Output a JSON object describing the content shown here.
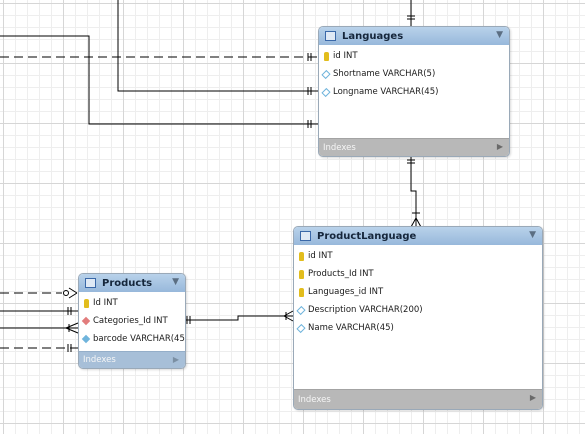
{
  "tables": {
    "languages": {
      "title": "Languages",
      "columns": [
        {
          "name": "id INT",
          "icon": "primary-key-icon"
        },
        {
          "name": "Shortname VARCHAR(5)",
          "icon": "column-icon"
        },
        {
          "name": "Longname VARCHAR(45)",
          "icon": "column-icon"
        }
      ],
      "indexes_label": "Indexes"
    },
    "product_language": {
      "title": "ProductLanguage",
      "columns": [
        {
          "name": "id INT",
          "icon": "primary-key-icon"
        },
        {
          "name": "Products_Id INT",
          "icon": "primary-key-icon"
        },
        {
          "name": "Languages_id INT",
          "icon": "primary-key-icon"
        },
        {
          "name": "Description VARCHAR(200)",
          "icon": "column-icon"
        },
        {
          "name": "Name VARCHAR(45)",
          "icon": "column-icon"
        }
      ],
      "indexes_label": "Indexes"
    },
    "products": {
      "title": "Products",
      "columns": [
        {
          "name": "Id INT",
          "icon": "primary-key-icon"
        },
        {
          "name": "Categories_Id INT",
          "icon": "foreign-key-icon"
        },
        {
          "name": "barcode VARCHAR(45)",
          "icon": "indexed-column-icon"
        }
      ],
      "indexes_label": "Indexes"
    }
  },
  "colors": {
    "header": "#97b8db",
    "connector": "#000000",
    "primary_key": "#e2bd1d",
    "foreign_key": "#e27c7c"
  }
}
